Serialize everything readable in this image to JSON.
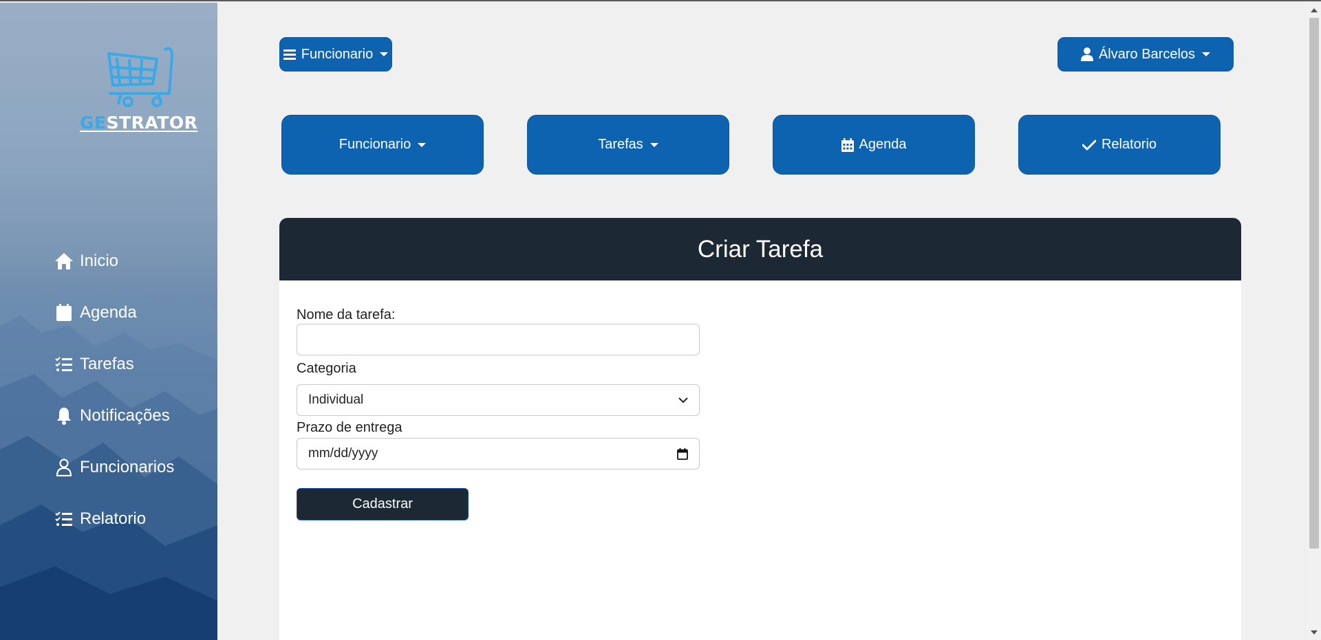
{
  "sidebar": {
    "logo_prefix": "GE",
    "logo_suffix": "STRATOR",
    "items": [
      {
        "label": "Inicio",
        "icon": "home-icon"
      },
      {
        "label": "Agenda",
        "icon": "calendar-icon"
      },
      {
        "label": "Tarefas",
        "icon": "list-check-icon"
      },
      {
        "label": "Notificações",
        "icon": "bell-icon"
      },
      {
        "label": "Funcionarios",
        "icon": "user-icon"
      },
      {
        "label": "Relatorio",
        "icon": "list-check-icon"
      }
    ]
  },
  "topbar": {
    "menu_label": "Funcionario",
    "user_label": "Álvaro Barcelos"
  },
  "actions": {
    "funcionario": "Funcionario",
    "tarefas": "Tarefas",
    "agenda": "Agenda",
    "relatorio": "Relatorio"
  },
  "form": {
    "title": "Criar Tarefa",
    "name_label": "Nome da tarefa:",
    "name_value": "",
    "category_label": "Categoria",
    "category_value": "Individual",
    "deadline_label": "Prazo de entrega",
    "deadline_placeholder": "mm/dd/yyyy",
    "submit_label": "Cadastrar"
  },
  "colors": {
    "primary": "#0d63b0",
    "dark": "#1c2833",
    "logo_accent": "#39a9e8"
  }
}
